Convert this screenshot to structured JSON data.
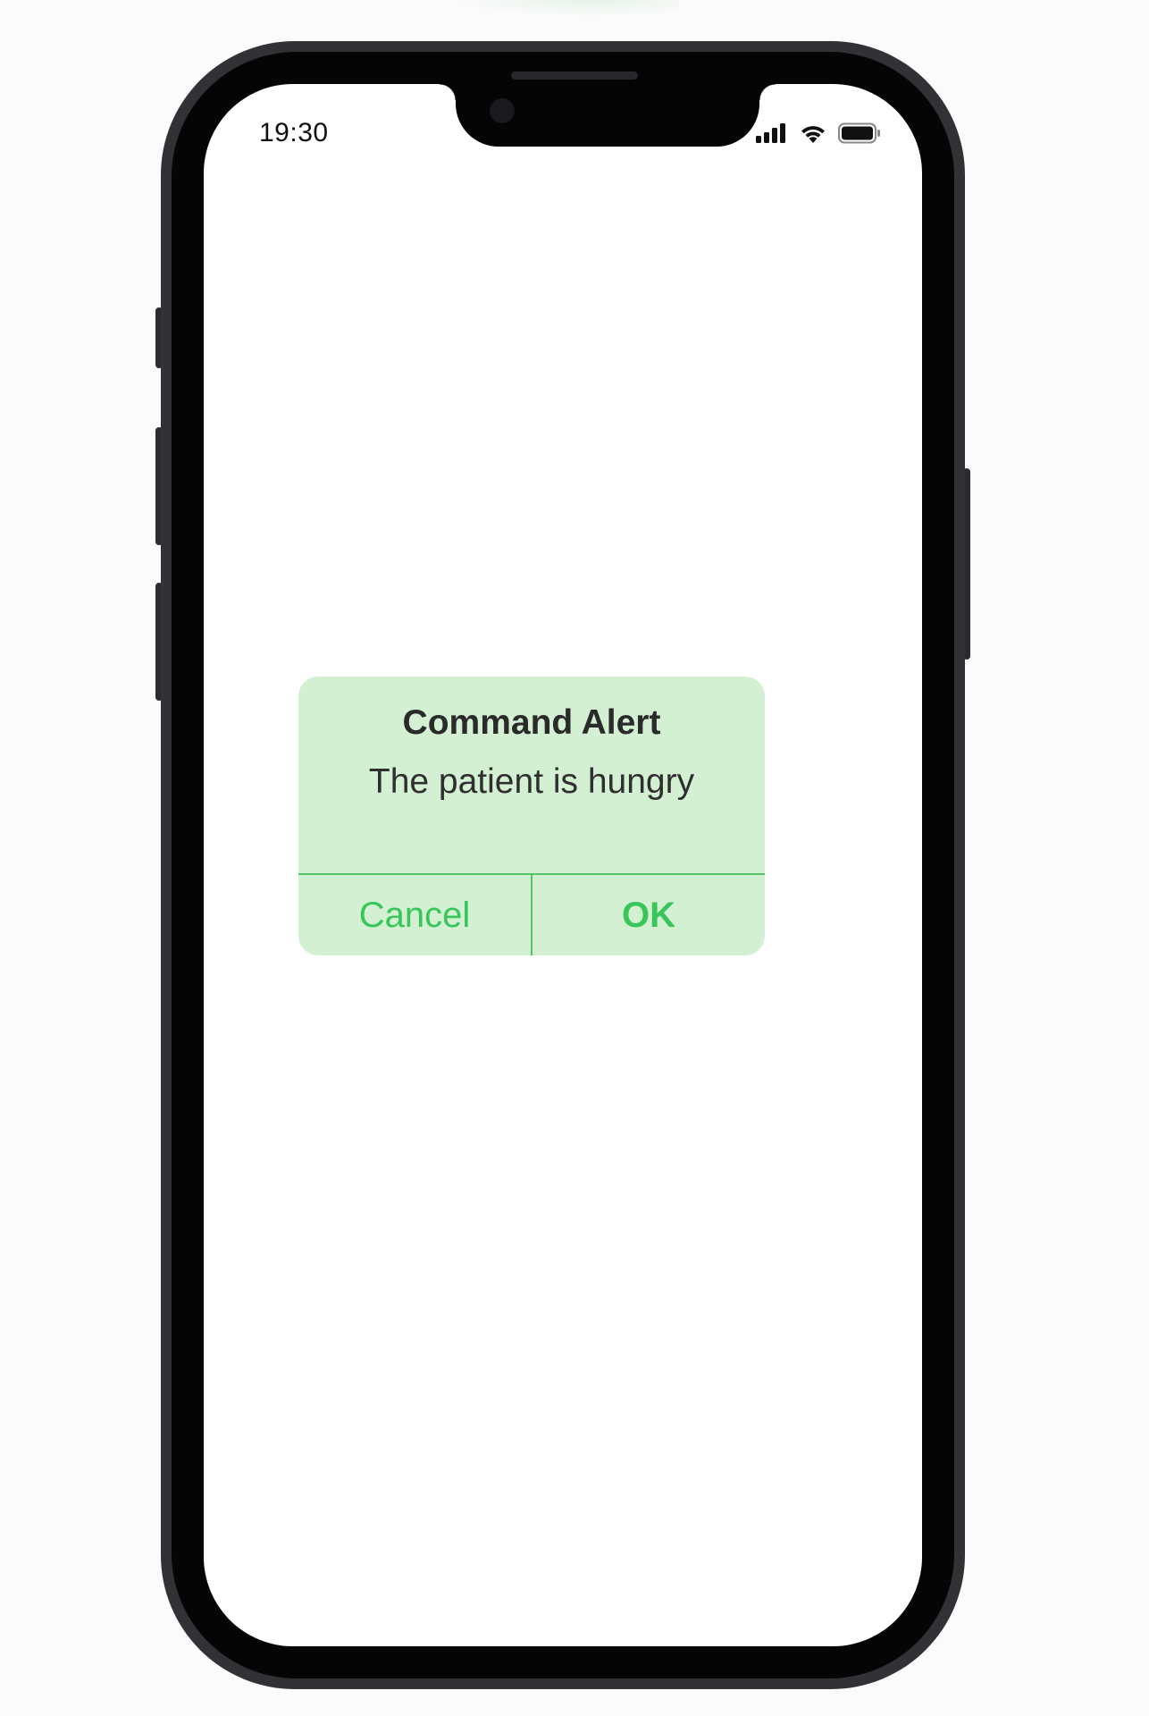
{
  "status_bar": {
    "time": "19:30",
    "icons": [
      "cellular-signal-icon",
      "wifi-icon",
      "battery-icon"
    ]
  },
  "alert": {
    "title": "Command Alert",
    "message": "The patient is hungry",
    "cancel_label": "Cancel",
    "ok_label": "OK"
  },
  "colors": {
    "alert_background": "#d3f0d3",
    "accent_green": "#38c65a",
    "divider_green": "#55c46a",
    "phone_frame": "#323236"
  }
}
